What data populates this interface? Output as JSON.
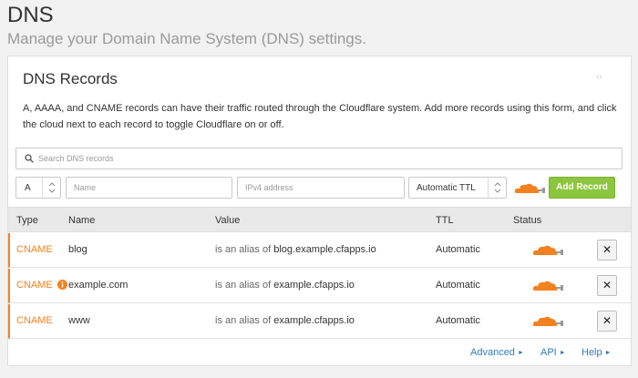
{
  "page": {
    "title": "DNS",
    "subtitle": "Manage your Domain Name System (DNS) settings."
  },
  "card": {
    "title": "DNS Records",
    "description": "A, AAAA, and CNAME records can have their traffic routed through the Cloudflare system. Add more records using this form, and click the cloud next to each record to toggle Cloudflare on or off."
  },
  "search": {
    "placeholder": "Search DNS records"
  },
  "form": {
    "type_value": "A",
    "name_placeholder": "Name",
    "ipv4_placeholder": "IPv4 address",
    "ttl_value": "Automatic TTL",
    "add_label": "Add Record"
  },
  "table": {
    "headers": {
      "type": "Type",
      "name": "Name",
      "value": "Value",
      "ttl": "TTL",
      "status": "Status"
    },
    "rows": [
      {
        "type": "CNAME",
        "name": "blog",
        "value_prefix": "is an alias of",
        "value": "blog.example.cfapps.io",
        "ttl": "Automatic",
        "delete": "✕"
      },
      {
        "type": "CNAME",
        "name": "example.com",
        "value_prefix": "is an alias of",
        "value": "example.cfapps.io",
        "ttl": "Automatic",
        "delete": "✕",
        "info": "info-icon"
      },
      {
        "type": "CNAME",
        "name": "www",
        "value_prefix": "is an alias of",
        "value": "example.cfapps.io",
        "ttl": "Automatic",
        "delete": "✕"
      }
    ]
  },
  "footer": {
    "advanced": "Advanced",
    "api": "API",
    "help": "Help"
  },
  "colors": {
    "accent_orange": "#f48120",
    "add_green": "#8cc63f",
    "link_blue": "#2f7bbf"
  }
}
